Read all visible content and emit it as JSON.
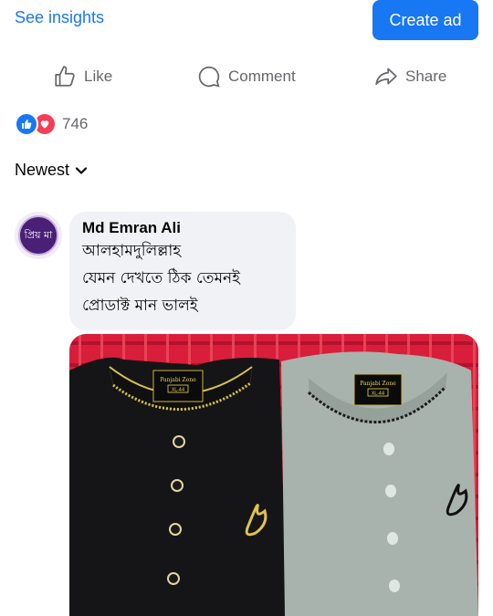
{
  "topbar": {
    "see_insights": "See insights",
    "create_ad": "Create ad"
  },
  "actions": {
    "like": "Like",
    "comment": "Comment",
    "share": "Share"
  },
  "reactions": {
    "count": "746",
    "types": [
      "like",
      "love"
    ]
  },
  "sort": {
    "label": "Newest"
  },
  "comment": {
    "author": "Md Emran Ali",
    "avatar_text": "প্রিয় মা",
    "lines": [
      "আলহামদুলিল্লাহ",
      "যেমন দেখতে ঠিক তেমনই",
      "প্রোডাক্ট মান ভালই"
    ],
    "photo": {
      "left_label": "Panjabi Zone",
      "left_size": "XL-44",
      "right_label": "Panjabi Zone",
      "right_size": "XL-44"
    }
  },
  "colors": {
    "accent": "#1877f2",
    "muted": "#65676b",
    "bubble": "#f0f2f5",
    "love": "#f33e58"
  }
}
